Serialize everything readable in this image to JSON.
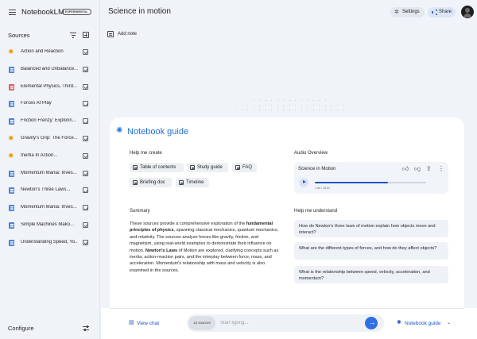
{
  "app": {
    "brand": "NotebookLM",
    "badge": "EXPERIMENTAL"
  },
  "sidebar": {
    "title": "Sources",
    "items": [
      {
        "label": "Action and Reaction",
        "icon": "star"
      },
      {
        "label": "Balanced and Unbalance...",
        "icon": "doc"
      },
      {
        "label": "Elemental Physics, Third...",
        "icon": "pdf"
      },
      {
        "label": "Forces At Play",
        "icon": "doc"
      },
      {
        "label": "Friction Frenzy: Explorin...",
        "icon": "doc"
      },
      {
        "label": "Gravity's Grip: The Force...",
        "icon": "star"
      },
      {
        "label": "Inertia In Action...",
        "icon": "star"
      },
      {
        "label": "Momentum Mania: Inves...",
        "icon": "doc"
      },
      {
        "label": "Newton's Three Laws...",
        "icon": "doc"
      },
      {
        "label": "Momentum Mania: Inves...",
        "icon": "doc"
      },
      {
        "label": "Simple Machines Mako...",
        "icon": "doc"
      },
      {
        "label": "Understanding Speed, Yo...",
        "icon": "doc"
      }
    ],
    "configure": "Configure"
  },
  "header": {
    "title": "Science in motion",
    "settings_label": "Settings",
    "share_label": "Share"
  },
  "notes": {
    "add_note": "Add note"
  },
  "guide": {
    "title": "Notebook guide",
    "help_create": "Help me create",
    "chips": [
      "Table of contents",
      "Study guide",
      "FAQ",
      "Briefing doc",
      "Timeline"
    ],
    "summary_label": "Summary",
    "summary": {
      "p1": "These sources provide a comprehensive exploration of the ",
      "b1": "fundamental principles of physics",
      "p2": ", spanning classical mechanics, quantum mechanics, and relativity. The sources analyze forces like gravity, friction, and magnetism, using real-world examples to demonstrate their influence on motion. ",
      "b2": "Newton's Laws",
      "p3": " of Motion are explored, clarifying concepts such as inertia, action-reaction pairs, and the interplay between force, mass, and acceleration. Momentum's relationship with mass and velocity is also examined in the sources."
    },
    "audio_label": "Audio Overview",
    "audio": {
      "title": "Science in Motion",
      "time": "1:40 / 10:01",
      "progress": 0.66
    },
    "understand_label": "Help me understand",
    "questions": [
      "How do Newton's three laws of motion explain how objects move and interact?",
      "What are the different types of forces, and how do they affect objects?",
      "What is the relationship between speed, velocity, acceleration, and momentum?"
    ]
  },
  "bottom": {
    "view_chat": "View chat",
    "sources_count": "12 sources",
    "input_placeholder": "Start typing...",
    "guide_toggle": "Notebook guide"
  },
  "colors": {
    "accent": "#1a56c4",
    "title_blue": "#1f6fd0",
    "send": "#2f6fe4"
  }
}
